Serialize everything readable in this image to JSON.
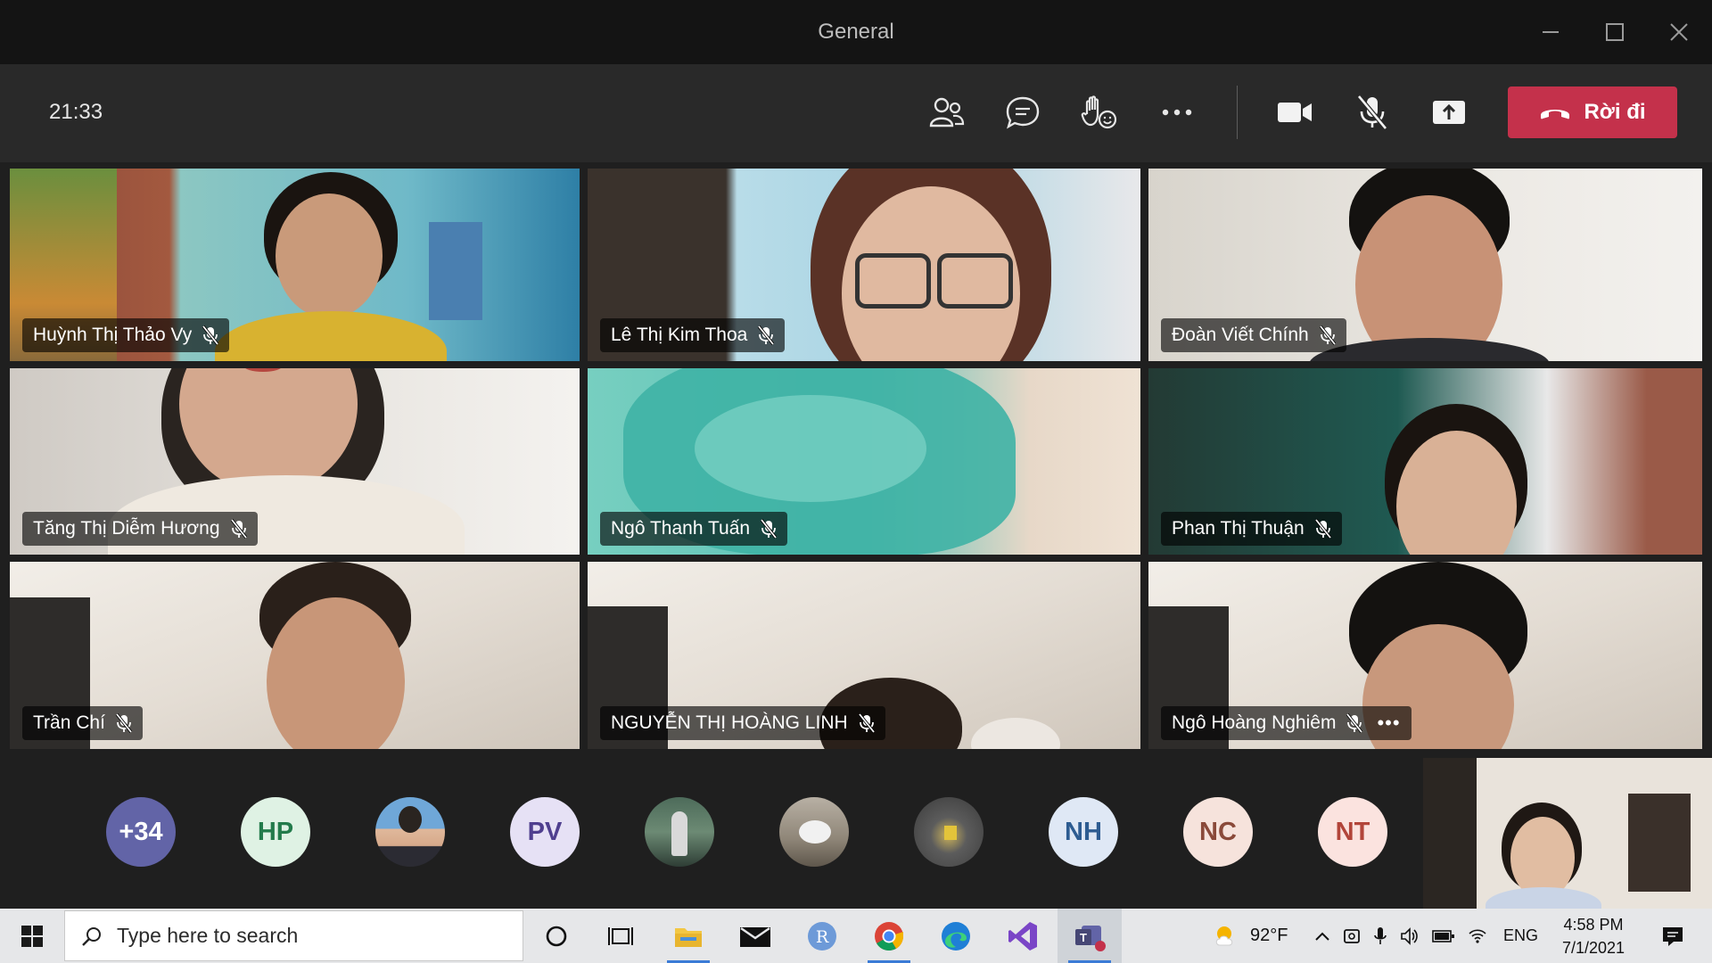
{
  "window": {
    "title": "General"
  },
  "toolbar": {
    "timer": "21:33",
    "leave_label": "Rời đi"
  },
  "participants": [
    {
      "name": "Huỳnh Thị Thảo Vy",
      "muted": true
    },
    {
      "name": "Lê Thị Kim Thoa",
      "muted": true
    },
    {
      "name": "Đoàn Viết Chính",
      "muted": true
    },
    {
      "name": "Tăng Thị Diễm Hương",
      "muted": true
    },
    {
      "name": "Ngô Thanh Tuấn",
      "muted": true
    },
    {
      "name": "Phan Thị Thuận",
      "muted": true
    },
    {
      "name": "Trần Chí",
      "muted": true
    },
    {
      "name": "NGUYỄN THỊ HOÀNG LINH",
      "muted": true
    },
    {
      "name": "Ngô Hoàng Nghiêm",
      "muted": true,
      "more": "•••"
    }
  ],
  "overflow_avatars": [
    {
      "label": "+34",
      "kind": "initials",
      "bg": "#6264a7",
      "fg": "#ffffff"
    },
    {
      "label": "HP",
      "kind": "initials",
      "bg": "#dff2e4",
      "fg": "#237b4b"
    },
    {
      "label": "",
      "kind": "photo",
      "icon": "person-photo-icon"
    },
    {
      "label": "PV",
      "kind": "initials",
      "bg": "#e6e1f5",
      "fg": "#4f3f8f"
    },
    {
      "label": "",
      "kind": "photo",
      "icon": "person-photo-icon"
    },
    {
      "label": "",
      "kind": "photo",
      "icon": "cat-photo-icon"
    },
    {
      "label": "",
      "kind": "photo",
      "icon": "person-photo-icon"
    },
    {
      "label": "NH",
      "kind": "initials",
      "bg": "#dfe8f5",
      "fg": "#2d5c91"
    },
    {
      "label": "NC",
      "kind": "initials",
      "bg": "#f6e3dc",
      "fg": "#8a4a3a"
    },
    {
      "label": "NT",
      "kind": "initials",
      "bg": "#fbe3df",
      "fg": "#b2453a"
    }
  ],
  "taskbar": {
    "search_placeholder": "Type here to search",
    "weather": "92°F",
    "language": "ENG",
    "time": "4:58 PM",
    "date": "7/1/2021"
  },
  "colors": {
    "accent": "#6264a7",
    "leave_red": "#c4314b",
    "taskbar_highlight": "#3b7bd6"
  }
}
